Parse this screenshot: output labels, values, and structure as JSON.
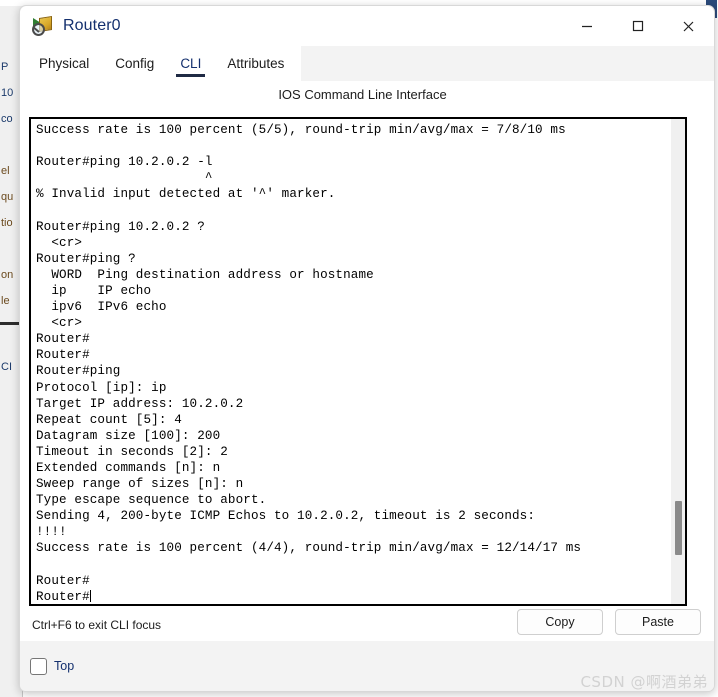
{
  "background": {
    "fragment_lines": [
      {
        "text": "P",
        "nav": true
      },
      {
        "text": "10",
        "nav": true
      },
      {
        "text": "co",
        "nav": true
      },
      {
        "text": "",
        "nav": false
      },
      {
        "text": "el",
        "nav": false
      },
      {
        "text": "qu",
        "nav": false
      },
      {
        "text": "tio",
        "nav": false
      },
      {
        "text": "",
        "nav": false
      },
      {
        "text": "on",
        "nav": false
      },
      {
        "text": "le",
        "nav": false
      }
    ],
    "lower_fragment": "CI"
  },
  "window": {
    "title": "Router0",
    "icon": "router-device-icon",
    "controls": {
      "minimize": "minimize-icon",
      "maximize": "maximize-icon",
      "close": "close-icon"
    }
  },
  "tabs": [
    {
      "label": "Physical",
      "active": false
    },
    {
      "label": "Config",
      "active": false
    },
    {
      "label": "CLI",
      "active": true
    },
    {
      "label": "Attributes",
      "active": false
    }
  ],
  "cli": {
    "heading": "IOS Command Line Interface",
    "hint": "Ctrl+F6 to exit CLI focus",
    "copy_label": "Copy",
    "paste_label": "Paste",
    "scroll_thumb_position": "near-bottom",
    "lines": [
      "Success rate is 100 percent (5/5), round-trip min/avg/max = 7/8/10 ms",
      "",
      "Router#ping 10.2.0.2 -l",
      "                      ^",
      "% Invalid input detected at '^' marker.",
      "",
      "Router#ping 10.2.0.2 ?",
      "  <cr>",
      "Router#ping ?",
      "  WORD  Ping destination address or hostname",
      "  ip    IP echo",
      "  ipv6  IPv6 echo",
      "  <cr>",
      "Router#",
      "Router#",
      "Router#ping",
      "Protocol [ip]: ip",
      "Target IP address: 10.2.0.2",
      "Repeat count [5]: 4",
      "Datagram size [100]: 200",
      "Timeout in seconds [2]: 2",
      "Extended commands [n]: n",
      "Sweep range of sizes [n]: n",
      "Type escape sequence to abort.",
      "Sending 4, 200-byte ICMP Echos to 10.2.0.2, timeout is 2 seconds:",
      "!!!!",
      "Success rate is 100 percent (4/4), round-trip min/avg/max = 12/14/17 ms",
      "",
      "Router#",
      "Router#"
    ]
  },
  "footer": {
    "top_checkbox_label": "Top",
    "top_checked": false,
    "watermark": "CSDN @啊酒弟弟"
  },
  "colors": {
    "title_text": "#14306E",
    "tab_underline": "#1F2A44",
    "terminal_border": "#000000",
    "window_chrome": "#F3F3F3",
    "scroll_thumb": "#8A8A8A"
  }
}
